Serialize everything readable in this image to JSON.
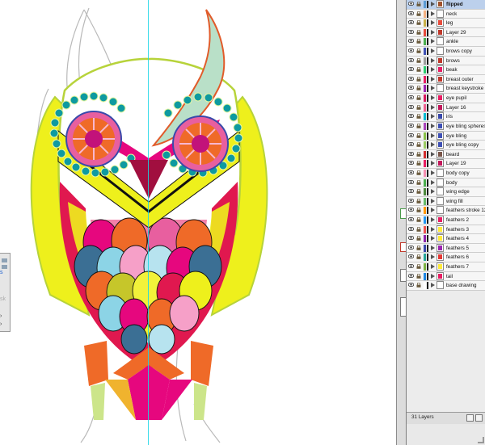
{
  "layers_panel": {
    "layers": [
      {
        "name": "flipped",
        "color": "#5b9bd5",
        "selected": true,
        "thumb": "#a0522d"
      },
      {
        "name": "neck",
        "color": "#f4b183",
        "selected": false,
        "thumb": "#ffffff"
      },
      {
        "name": "leg",
        "color": "#c9b24a",
        "selected": false,
        "thumb": "#e74c3c"
      },
      {
        "name": "Layer 29",
        "color": "#e74c3c",
        "selected": false,
        "thumb": "#c0392b"
      },
      {
        "name": "ankle",
        "color": "#4caf50",
        "selected": false,
        "thumb": "#ffffff"
      },
      {
        "name": "brows copy",
        "color": "#3f51b5",
        "selected": false,
        "thumb": "#ffffff"
      },
      {
        "name": "brows",
        "color": "#9e9e9e",
        "selected": false,
        "thumb": "#c0392b"
      },
      {
        "name": "beak",
        "color": "#2ecc71",
        "selected": false,
        "thumb": "#e91e63"
      },
      {
        "name": "breast outer",
        "color": "#e91e63",
        "selected": false,
        "thumb": "#c0392b"
      },
      {
        "name": "breast keystroke",
        "color": "#9c27b0",
        "selected": false,
        "thumb": "#ffffff"
      },
      {
        "name": "eye pupil",
        "color": "#d81b60",
        "selected": false,
        "thumb": "#e91e63"
      },
      {
        "name": "Layer 16",
        "color": "#f06292",
        "selected": false,
        "thumb": "#c2185b"
      },
      {
        "name": "iris",
        "color": "#00bcd4",
        "selected": false,
        "thumb": "#3949ab"
      },
      {
        "name": "eye bling spheres",
        "color": "#ab47bc",
        "selected": false,
        "thumb": "#3f51b5"
      },
      {
        "name": "eye bling",
        "color": "#8bc34a",
        "selected": false,
        "thumb": "#3f51b5"
      },
      {
        "name": "eye bling copy",
        "color": "#9ccc65",
        "selected": false,
        "thumb": "#3f51b5"
      },
      {
        "name": "beard",
        "color": "#d32f2f",
        "selected": false,
        "thumb": "#795548"
      },
      {
        "name": "Layer 19",
        "color": "#e91e63",
        "selected": false,
        "thumb": "#c2185b"
      },
      {
        "name": "body copy",
        "color": "#f48fb1",
        "selected": false,
        "thumb": "#ffffff"
      },
      {
        "name": "body",
        "color": "#4caf50",
        "selected": false,
        "thumb": "#ffffff"
      },
      {
        "name": "wing edge",
        "color": "#4e8a3e",
        "selected": false,
        "thumb": "#ffffff"
      },
      {
        "name": "wing fill",
        "color": "#66bb6a",
        "selected": false,
        "thumb": "#ffffff"
      },
      {
        "name": "feathers stroke 12/08",
        "color": "#ff9800",
        "selected": false,
        "thumb": "#ffffff"
      },
      {
        "name": "feathers 2",
        "color": "#2196f3",
        "selected": false,
        "thumb": "#e91e63"
      },
      {
        "name": "feathers 3",
        "color": "#ef5350",
        "selected": false,
        "thumb": "#ffeb3b"
      },
      {
        "name": "feathers 4",
        "color": "#8e24aa",
        "selected": false,
        "thumb": "#ffeb3b"
      },
      {
        "name": "feathers 5",
        "color": "#3949ab",
        "selected": false,
        "thumb": "#9c27b0"
      },
      {
        "name": "feathers 6",
        "color": "#26a69a",
        "selected": false,
        "thumb": "#e53935"
      },
      {
        "name": "feathers 7",
        "color": "#7cb342",
        "selected": false,
        "thumb": "#ffeb3b"
      },
      {
        "name": "tail",
        "color": "#1e88e5",
        "selected": false,
        "thumb": "#e91e63"
      },
      {
        "name": "base drawing",
        "color": "#ffffff",
        "selected": false,
        "thumb": "#ffffff"
      }
    ],
    "layer_count": "31 Layers"
  },
  "left_panel": {
    "fragment_1": "s",
    "fragment_2": "sk"
  },
  "artwork": {
    "colors": {
      "outline_green": "#b7d33a",
      "yellow": "#eef01c",
      "magenta": "#e6077e",
      "teal": "#0e9aa0",
      "pink": "#e85f9f",
      "orange": "#ef6a28",
      "crimson": "#e0184f",
      "guide_cyan": "#19d6e6"
    }
  }
}
